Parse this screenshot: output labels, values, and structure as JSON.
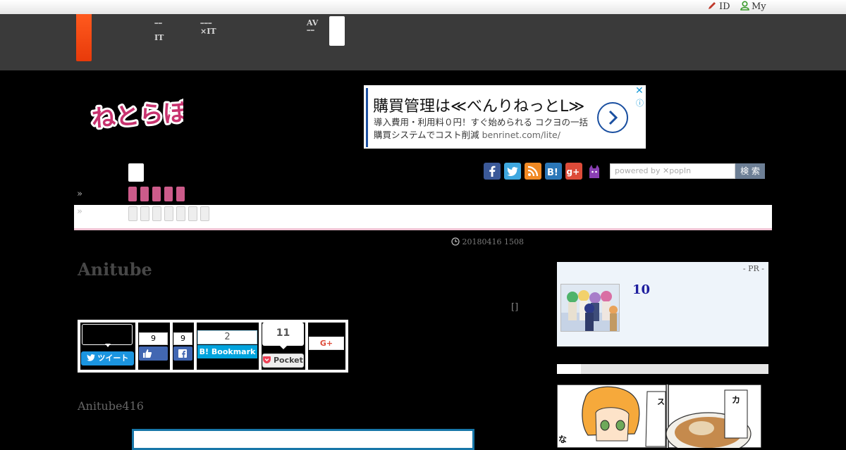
{
  "topbar": {
    "id_label": "ID",
    "my_label": "My"
  },
  "nav": {
    "item1_line1": "ｰｰ",
    "item1_line2": "IT",
    "item2_line1": "ｰｰｰ",
    "item2_line2": "×IT",
    "item3_line1": "AV",
    "item3_line2": "ｰｰ"
  },
  "logo": {
    "text": "ねとらぼ"
  },
  "ad": {
    "title": "購買管理は≪べんりねっとL≫",
    "desc": "導入費用・利用料０円！すぐ始められる コクヨの一括購買システムでコスト削減",
    "url": "benrinet.com/lite/",
    "close": "✕",
    "info": "ⓘ"
  },
  "breadcrumb": {
    "sep": "»"
  },
  "social_icons": [
    "facebook-icon",
    "twitter-icon",
    "rss-icon",
    "hatena-icon",
    "google-plus-icon",
    "cat-icon"
  ],
  "search": {
    "placeholder": "powered by ✕popIn",
    "button": "検 索"
  },
  "article": {
    "date": "20180416 1508",
    "title": "Anitube",
    "bracket": "[]",
    "lead": "Anitube416"
  },
  "share": {
    "tweet": "ツイート",
    "like_count": "9",
    "fb_count": "9",
    "bookmark_count": "2",
    "bookmark_label": "Bookmark",
    "pocket_count": "11",
    "pocket_label": "Pocket",
    "gplus_label": "G+"
  },
  "sidebar": {
    "pr_label": "- PR -",
    "pr_title": "10"
  },
  "colors": {
    "brand_orange": "#f04a14",
    "pink": "#cc5b8a",
    "link_blue": "#1e1e9e",
    "twitter": "#1b95e0",
    "facebook": "#3b5998",
    "hatena": "#00a4de"
  }
}
